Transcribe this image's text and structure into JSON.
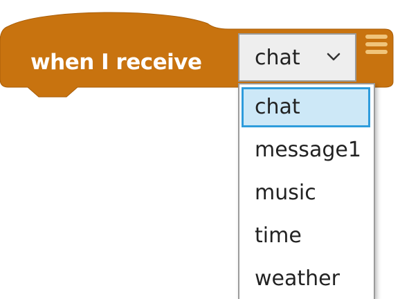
{
  "block": {
    "label": "when I receive",
    "color": "#c8730f"
  },
  "dropdown": {
    "selected_value": "chat",
    "chevron_icon": "chevron-down-icon"
  },
  "menu_icon": "hamburger-menu-icon",
  "menu": {
    "items": [
      {
        "label": "chat",
        "selected": true
      },
      {
        "label": "message1",
        "selected": false
      },
      {
        "label": "music",
        "selected": false
      },
      {
        "label": "time",
        "selected": false
      },
      {
        "label": "weather",
        "selected": false
      }
    ],
    "highlight_color": "#cde8f7",
    "highlight_border": "#2e9cdc"
  }
}
